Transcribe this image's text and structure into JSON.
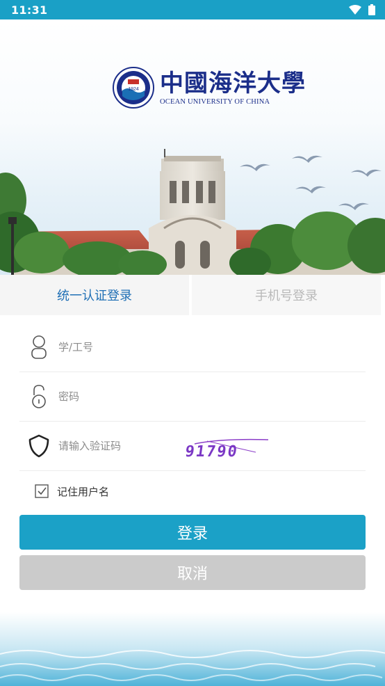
{
  "status_bar": {
    "time": "11:31",
    "icons": [
      "wifi-icon",
      "battery-icon"
    ]
  },
  "header": {
    "logo_cn": "中國海洋大學",
    "logo_en": "OCEAN UNIVERSITY OF CHINA",
    "emblem_year": "1924"
  },
  "tabs": [
    {
      "label": "统一认证登录",
      "active": true
    },
    {
      "label": "手机号登录",
      "active": false
    }
  ],
  "form": {
    "username": {
      "placeholder": "学/工号",
      "value": ""
    },
    "password": {
      "placeholder": "密码",
      "value": ""
    },
    "captcha": {
      "placeholder": "请输入验证码",
      "value": "",
      "image_text": "91790"
    },
    "remember": {
      "label": "记住用户名",
      "checked": true
    }
  },
  "buttons": {
    "login": "登录",
    "cancel": "取消"
  },
  "colors": {
    "status_bar": "#1aa0c6",
    "primary": "#1ba1c7",
    "tab_active_text": "#1f6fb5",
    "cancel": "#cbcbcb",
    "logo": "#1b2e8a"
  }
}
